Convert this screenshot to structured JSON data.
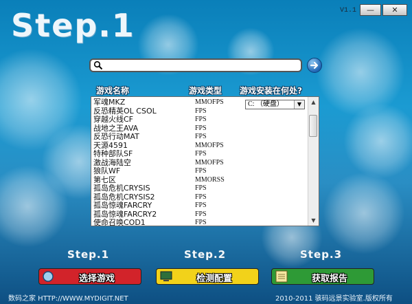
{
  "app": {
    "version": "V1.1",
    "minimize_label": "—",
    "close_label": "✕",
    "title": "Step.1"
  },
  "search": {
    "value": "",
    "placeholder": ""
  },
  "columns": {
    "name": "游戏名称",
    "type": "游戏类型",
    "install": "游戏安装在何处?"
  },
  "drive": {
    "selected": "C: （硬盘）"
  },
  "games": [
    {
      "name": "军魂MKZ",
      "type": "MMOFPS"
    },
    {
      "name": "反恐精英OL CSOL",
      "type": "FPS"
    },
    {
      "name": "穿越火线CF",
      "type": "FPS"
    },
    {
      "name": "战地之王AVA",
      "type": "FPS"
    },
    {
      "name": "反恐行动MAT",
      "type": "FPS"
    },
    {
      "name": "天源4591",
      "type": "MMOFPS"
    },
    {
      "name": "特种部队SF",
      "type": "FPS"
    },
    {
      "name": "激战海陆空",
      "type": "MMOFPS"
    },
    {
      "name": "狼队WF",
      "type": "FPS"
    },
    {
      "name": "第七区",
      "type": "MMORSS"
    },
    {
      "name": "孤岛危机CRYSIS",
      "type": "FPS"
    },
    {
      "name": "孤岛危机CRYSIS2",
      "type": "FPS"
    },
    {
      "name": "孤岛惊魂FARCRY",
      "type": "FPS"
    },
    {
      "name": "孤岛惊魂FARCRY2",
      "type": "FPS"
    },
    {
      "name": "使命召唤COD1",
      "type": "FPS"
    }
  ],
  "steps": [
    {
      "label": "Step.1",
      "button": "选择游戏",
      "color": "#d2232a"
    },
    {
      "label": "Step.2",
      "button": "检测配置",
      "color": "#f2d21a"
    },
    {
      "label": "Step.3",
      "button": "获取报告",
      "color": "#2e9a36"
    }
  ],
  "footer": {
    "left": "数码之家 HTTP://WWW.MYDIGIT.NET",
    "right": "2010-2011 骇码远景实验室.版权所有"
  }
}
